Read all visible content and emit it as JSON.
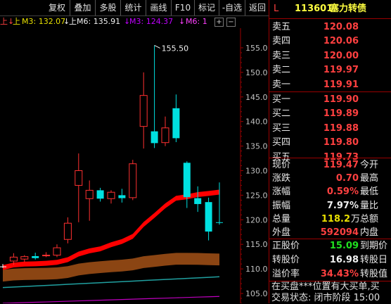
{
  "toolbar": {
    "items": [
      "复权",
      "叠加",
      "多股",
      "统计",
      "画线",
      "F10",
      "标记",
      "-自选",
      "返回"
    ]
  },
  "ma": {
    "up_label": "上",
    "ma3_label": "M3: 132.07",
    "up6_label": "上M6: 135.91",
    "m3b_label": "M3: 124.37",
    "m6b_label": "M6: 1",
    "arrow_down": "↓",
    "ma3_color": "#e8e000",
    "m6_color": "#ffffff",
    "m3b_color": "#c000ff",
    "m6b_color": "#ff40ff"
  },
  "corner": {
    "plus": "+",
    "minus": "−"
  },
  "chart_data": {
    "type": "candlestick",
    "price_ticks": [
      "155.0",
      "150.0",
      "145.0",
      "140.0",
      "135.0",
      "130.0",
      "125.0",
      "120.0",
      "115.0",
      "110.0",
      "105.0"
    ],
    "price_range": [
      103.0,
      159.0
    ],
    "high_marker": "155.50",
    "candles": [
      {
        "o": 110.5,
        "c": 110.5,
        "h": 111.0,
        "l": 110.2
      },
      {
        "o": 111.6,
        "c": 112.4,
        "h": 113.2,
        "l": 110.8
      },
      {
        "o": 112.0,
        "c": 112.5,
        "h": 112.8,
        "l": 111.4
      },
      {
        "o": 112.6,
        "c": 112.2,
        "h": 113.3,
        "l": 111.9
      },
      {
        "o": 112.7,
        "c": 112.8,
        "h": 113.4,
        "l": 112.4
      },
      {
        "o": 112.8,
        "c": 114.3,
        "h": 115.0,
        "l": 112.4
      },
      {
        "o": 116.0,
        "c": 119.3,
        "h": 120.5,
        "l": 115.2
      },
      {
        "o": 127.0,
        "c": 130.0,
        "h": 133.5,
        "l": 119.5
      },
      {
        "o": 124.3,
        "c": 126.0,
        "h": 128.0,
        "l": 119.8
      },
      {
        "o": 126.0,
        "c": 124.3,
        "h": 126.5,
        "l": 123.7
      },
      {
        "o": 124.3,
        "c": 125.6,
        "h": 126.0,
        "l": 123.3
      },
      {
        "o": 125.0,
        "c": 124.4,
        "h": 126.3,
        "l": 123.5
      },
      {
        "o": 124.5,
        "c": 131.4,
        "h": 132.2,
        "l": 124.0
      },
      {
        "o": 139.0,
        "c": 145.3,
        "h": 150.0,
        "l": 134.5
      },
      {
        "o": 138.0,
        "c": 135.6,
        "h": 155.5,
        "l": 134.6
      },
      {
        "o": 135.7,
        "c": 138.7,
        "h": 141.0,
        "l": 135.0
      },
      {
        "o": 142.7,
        "c": 136.6,
        "h": 145.5,
        "l": 135.8
      },
      {
        "o": 131.6,
        "c": 124.6,
        "h": 131.9,
        "l": 122.4
      },
      {
        "o": 124.4,
        "c": 123.2,
        "h": 126.8,
        "l": 121.6
      },
      {
        "o": 123.6,
        "c": 117.6,
        "h": 124.5,
        "l": 115.8
      },
      {
        "o": 119.5,
        "c": 119.4,
        "h": 127.6,
        "l": 119.0
      }
    ],
    "colors": {
      "up": "#ff3030",
      "down": "#00e0e0",
      "flat": "#ffffff",
      "axis": "#9a0000",
      "tick": "#c0c0c0"
    }
  },
  "header": {
    "tag": "L",
    "code": "113601",
    "name": "塞力转债"
  },
  "asks": [
    {
      "label": "卖五",
      "price": "120.08"
    },
    {
      "label": "卖四",
      "price": "120.06"
    },
    {
      "label": "卖三",
      "price": "120.00"
    },
    {
      "label": "卖二",
      "price": "119.97"
    },
    {
      "label": "卖一",
      "price": "119.91"
    }
  ],
  "bids": [
    {
      "label": "买一",
      "price": "119.90"
    },
    {
      "label": "买二",
      "price": "119.89"
    },
    {
      "label": "买三",
      "price": "119.88"
    },
    {
      "label": "买四",
      "price": "119.80"
    },
    {
      "label": "买五",
      "price": "119.73"
    }
  ],
  "quote": [
    {
      "label": "现价",
      "value": "119.47",
      "label2": "今开",
      "color": "red"
    },
    {
      "label": "涨跌",
      "value": "0.70",
      "label2": "最高",
      "color": "red"
    },
    {
      "label": "涨幅",
      "value": "0.59%",
      "label2": "最低",
      "color": "red"
    },
    {
      "label": "振幅",
      "value": "7.97%",
      "label2": "量比",
      "color": "white"
    },
    {
      "label": "总量",
      "value": "118.2",
      "unit": "万",
      "label2": "总额",
      "color": "yellow"
    },
    {
      "label": "外盘",
      "value": "592094",
      "label2": "内盘",
      "color": "red"
    }
  ],
  "stock": [
    {
      "label": "正股价",
      "value": "15.09",
      "label2": "到期价",
      "color": "green"
    },
    {
      "label": "转股价",
      "value": "16.98",
      "label2": "转股日",
      "color": "white"
    },
    {
      "label": "溢价率",
      "value": "34.43%",
      "label2": "转股值",
      "color": "red"
    }
  ],
  "footer": {
    "line1": "在买盘***位置有大买单,买",
    "line2": "交易状态: 闭市阶段  15:00"
  }
}
